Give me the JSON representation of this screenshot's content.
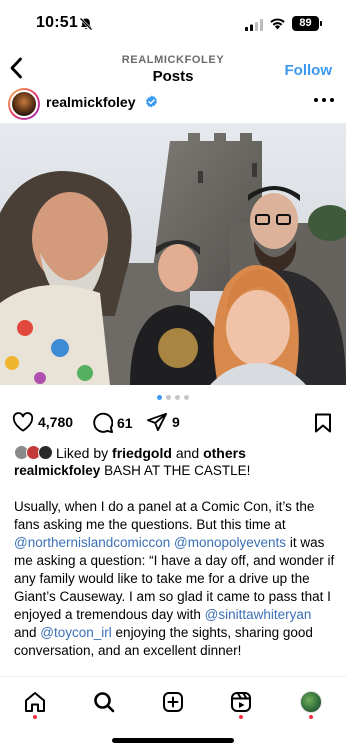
{
  "status_bar": {
    "time": "10:51",
    "battery": "89",
    "icons": [
      "bell-slash-icon",
      "signal-icon",
      "wifi-icon",
      "battery-icon"
    ]
  },
  "header": {
    "subtitle": "REALMICKFOLEY",
    "title": "Posts",
    "follow_label": "Follow",
    "accent_color": "#3b99f2"
  },
  "post": {
    "username": "realmickfoley",
    "verified": true,
    "carousel": {
      "count": 4,
      "active_index": 0
    },
    "likes_count": "4,780",
    "comments_count": "61",
    "shares_count": "9",
    "liked_by": {
      "prefix": "Liked by",
      "user": "friedgold",
      "connector": "and",
      "others": "others"
    },
    "caption": {
      "username": "realmickfoley",
      "headline": "BASH AT THE CASTLE!",
      "p1_a": "Usually, when I do a panel at a Comic Con, it’s the fans asking me the questions. But this time at",
      "mention_1": "@northernislandcomiccon",
      "mention_2": "@monopolyevents",
      "p1_b": "it was me asking a question: “I have a day off, and wonder if any family would like to take me for a drive up the Giant’s Causeway. I am so glad it came to pass that I enjoyed a tremendous day with",
      "mention_3": "@sinittawhiteryan",
      "and_text": "and",
      "mention_4": "@toycon_irl",
      "p1_c": "enjoying the sights, sharing good conversation, and an excellent dinner!"
    }
  },
  "bottom_nav": {
    "items": [
      "home-icon",
      "search-icon",
      "create-icon",
      "reels-icon",
      "profile-avatar"
    ]
  }
}
